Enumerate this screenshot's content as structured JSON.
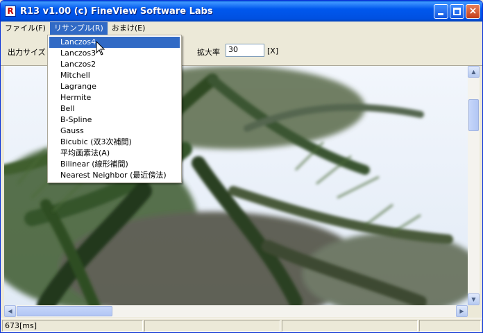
{
  "window": {
    "title": "R13 v1.00 (c) FineView Software Labs",
    "icon_letter": "R",
    "controls": {
      "minimize": "minimize-icon",
      "maximize": "maximize-icon",
      "close": "×"
    }
  },
  "menubar": {
    "items": [
      "ファイル(F)",
      "リサンプル(R)",
      "おまけ(E)"
    ],
    "active_index": 1
  },
  "toolbar": {
    "output_size_label": "出力サイズ",
    "zoom_label": "拡大率",
    "zoom_value": "30",
    "zoom_unit": "[X]"
  },
  "resample_menu": {
    "items": [
      "Lanczos4",
      "Lanczos3",
      "Lanczos2",
      "Mitchell",
      "Lagrange",
      "Hermite",
      "Bell",
      "B-Spline",
      "Gauss",
      "Bicubic (双3次補間)",
      "平均画素法(A)",
      "Bilinear (線形補間)",
      "Nearest Neighbor (最近傍法)"
    ],
    "highlighted_index": 0
  },
  "status": {
    "elapsed": "673[ms]",
    "cell2": "",
    "cell3": "",
    "cell4": ""
  },
  "colors": {
    "titlebar": "#0054E3",
    "menu_highlight": "#316AC5",
    "face": "#ECE9D8"
  },
  "scroll": {
    "vertical_position": 0.2,
    "horizontal_position": 0.0
  }
}
